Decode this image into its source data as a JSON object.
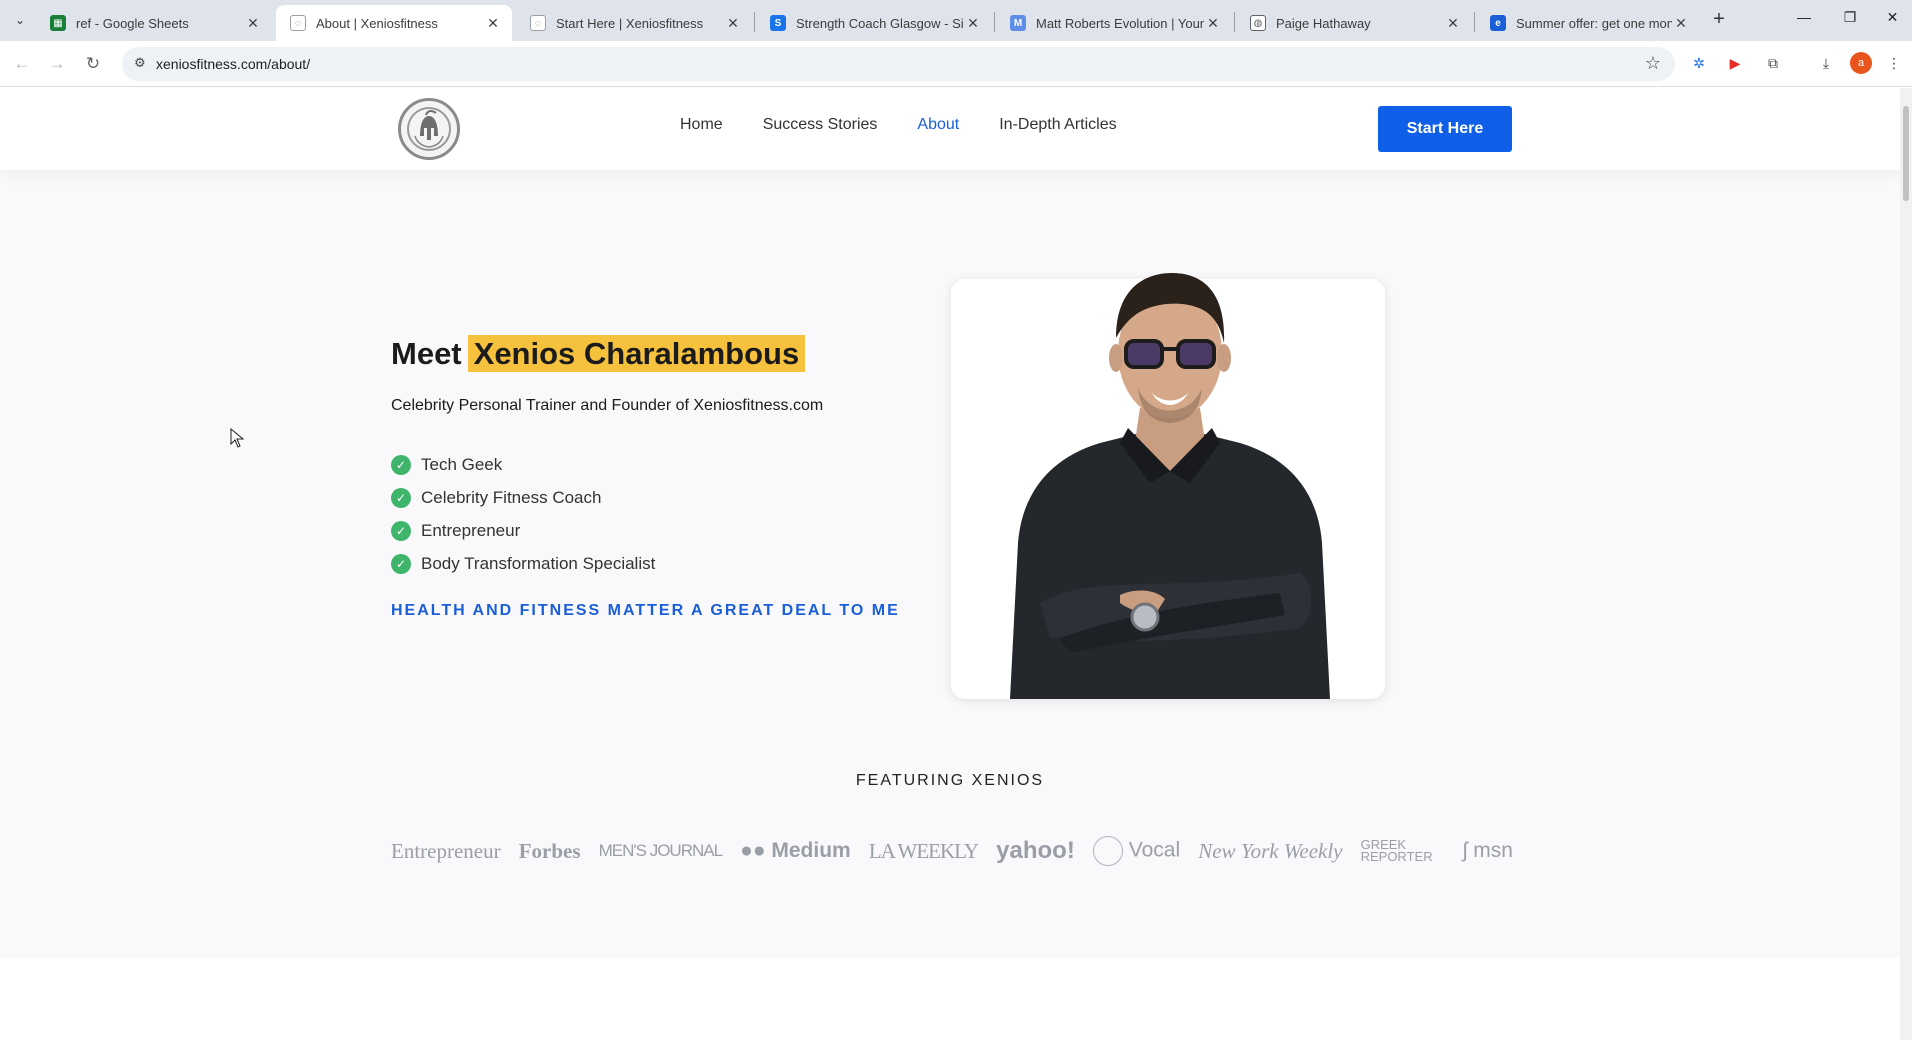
{
  "browser": {
    "tabs": [
      {
        "title": "ref - Google Sheets",
        "active": false,
        "icon": "sheets-icon",
        "color": "#188038"
      },
      {
        "title": "About | Xeniosfitness",
        "active": true,
        "icon": "site-icon",
        "color": "#9aa0a6"
      },
      {
        "title": "Start Here | Xeniosfitness",
        "active": false,
        "icon": "site-icon",
        "color": "#9aa0a6"
      },
      {
        "title": "Strength Coach Glasgow - Simp",
        "active": false,
        "icon": "s-logo-icon",
        "color": "#1a73e8"
      },
      {
        "title": "Matt Roberts Evolution | Young",
        "active": false,
        "icon": "m-logo-icon",
        "color": "#5f8de8"
      },
      {
        "title": "Paige Hathaway",
        "active": false,
        "icon": "globe-icon",
        "color": "#5f6368"
      },
      {
        "title": "Summer offer: get one month f",
        "active": false,
        "icon": "offer-icon",
        "color": "#1a5fd6"
      }
    ],
    "url": "xeniosfitness.com/about/",
    "profile_initial": "a"
  },
  "site": {
    "nav": [
      {
        "label": "Home",
        "active": false
      },
      {
        "label": "Success Stories",
        "active": false
      },
      {
        "label": "About",
        "active": true
      },
      {
        "label": "In-Depth Articles",
        "active": false
      }
    ],
    "cta_label": "Start Here"
  },
  "hero": {
    "title_prefix": "Meet",
    "title_name": "Xenios Charalambous",
    "subtitle": "Celebrity Personal Trainer and Founder of Xeniosfitness.com",
    "bullets": [
      "Tech Geek",
      "Celebrity Fitness Coach",
      "Entrepreneur",
      "Body Transformation Specialist"
    ],
    "tagline": "HEALTH AND FITNESS MATTER A GREAT DEAL TO ME"
  },
  "featuring": {
    "heading": "FEATURING XENIOS",
    "logos": [
      "Entrepreneur",
      "Forbes",
      "MEN'S JOURNAL",
      "Medium",
      "LA WEEKLY",
      "yahoo!",
      "Vocal",
      "New York Weekly",
      "GREEK REPORTER",
      "msn"
    ]
  },
  "colors": {
    "accent": "#0f5fe9",
    "highlight": "#f6c23e",
    "check": "#3fb56b"
  }
}
